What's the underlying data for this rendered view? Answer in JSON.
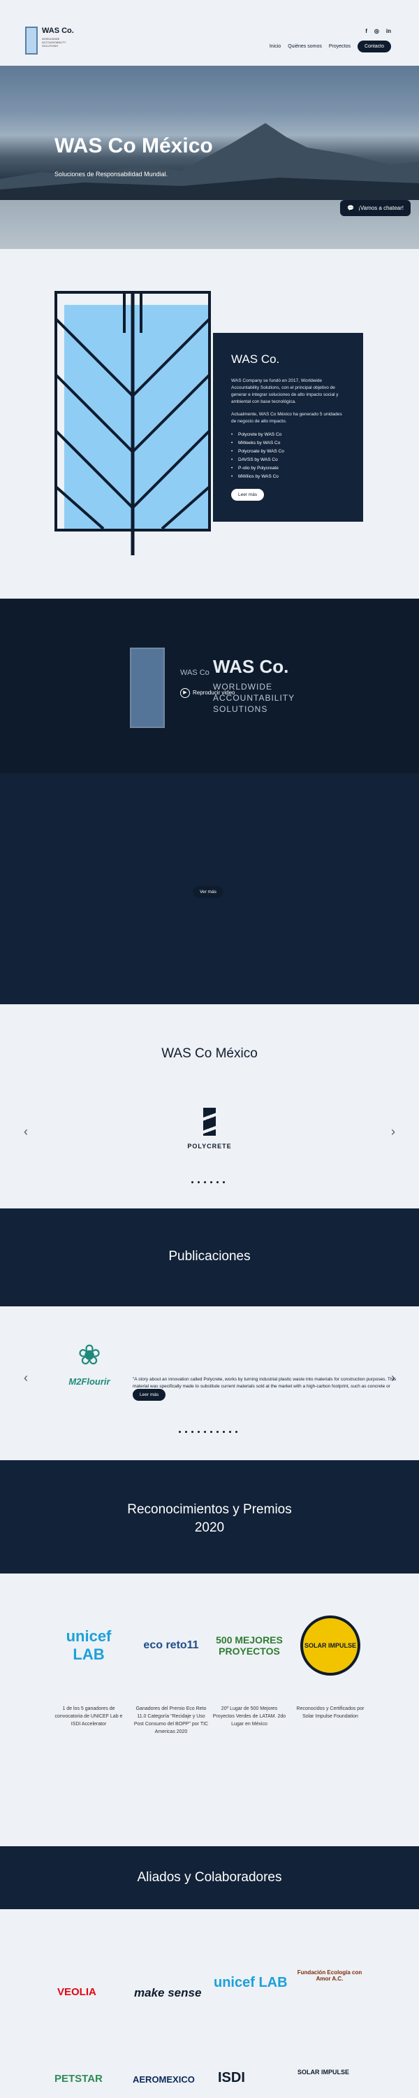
{
  "header": {
    "social": [
      "f",
      "◎",
      "in"
    ],
    "brand_name": "WAS Co.",
    "brand_tagline": "WORLDWIDE ACCOUNTABILITY SOLUTIONS",
    "nav": [
      "Inicio",
      "Quiénes somos",
      "Proyectos"
    ],
    "contact_label": "Contacto"
  },
  "hero": {
    "title": "WAS Co México",
    "subtitle": "Soluciones de Responsabilidad Mundial.",
    "chat_label": "¡Vamos a chatear!"
  },
  "about": {
    "title": "WAS Co.",
    "p1": "WAS Company se fundó en 2017, Worldwide Accountability Solutions, con el principal objetivo de generar e integrar soluciones de alto impacto social y ambiental con base tecnológica.",
    "p2": "Actualmente, WAS Co México ha generado 5 unidades de negocio de alto impacto.",
    "units": [
      "Polycrete by WAS Co",
      "MWeeks by WAS Co",
      "Polycroate by WAS Co",
      "DAVSS by WAS Co",
      "P-olio by Polycreate",
      "MWilios by WAS Co"
    ],
    "read_more": "Leer más"
  },
  "video": {
    "title": "WAS Co.",
    "subtitle_lines": [
      "WORLDWIDE",
      "ACCOUNTABILITY",
      "SOLUTIONS"
    ],
    "small_title": "WAS Co",
    "play_label": "Reproducir video",
    "view_more": "Ver más"
  },
  "slider": {
    "title": "WAS Co México",
    "logo_word": "POLYCRETE",
    "prev": "‹",
    "next": "›"
  },
  "publications": {
    "title": "Publicaciones",
    "logo_name": "M2Flourir",
    "quote": "\"A story about an innovation called Polycrete, works by turning industrial plastic waste into materials for construction purposes. This material was specifically made to substitute current materials sold at the market with a high-carbon footprint, such as concrete or cement\" (2021)",
    "read_more": "Leer más"
  },
  "awards": {
    "title_line1": "Reconocimientos y Premios",
    "title_line2": "2020",
    "items": [
      {
        "logo": "unicef LAB",
        "caption": "1 de los 5 ganadores de convocatoria de UNICEF Lab e ISDI Accelerator"
      },
      {
        "logo": "eco reto11",
        "caption": "Ganadores del Premio Eco Reto 11.0 Categoría \"Recidaje y Uso Post Consumo del BOPP\" por TIC Americas 2020"
      },
      {
        "logo": "500 MEJORES PROYECTOS",
        "caption": "20º Lugar de 500 Mejores Proyectos Verdes de LATAM. 2do Lugar en México"
      },
      {
        "logo": "SOLAR IMPULSE",
        "caption": "Reconocidos y Certificados por Solar Impulse Foundation"
      }
    ]
  },
  "partners": {
    "title": "Aliados y Colaboradores",
    "logos": [
      "VEOLIA",
      "make sense",
      "unicef LAB",
      "Fundación Ecología con Amor A.C.",
      "PETSTAR",
      "AEROMEXICO",
      "ISDI",
      "SOLAR IMPULSE"
    ]
  }
}
